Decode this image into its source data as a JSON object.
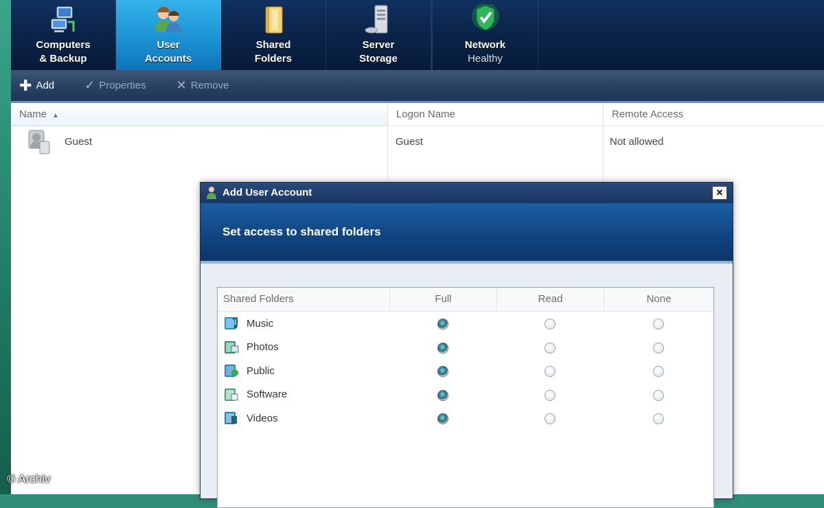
{
  "nav": {
    "tabs": [
      {
        "line1": "Computers",
        "line2": "& Backup",
        "icon": "computers-icon"
      },
      {
        "line1": "User",
        "line2": "Accounts",
        "icon": "users-icon"
      },
      {
        "line1": "Shared",
        "line2": "Folders",
        "icon": "folder-icon"
      },
      {
        "line1": "Server",
        "line2": "Storage",
        "icon": "server-icon"
      },
      {
        "line1": "Network",
        "line2": "Healthy",
        "icon": "shield-check-icon"
      }
    ],
    "active_index": 1
  },
  "toolbar": {
    "add_label": "Add",
    "properties_label": "Properties",
    "remove_label": "Remove"
  },
  "list": {
    "columns": {
      "name": "Name",
      "logon": "Logon Name",
      "remote": "Remote Access"
    },
    "rows": [
      {
        "name": "Guest",
        "logon": "Guest",
        "remote": "Not allowed"
      }
    ]
  },
  "dialog": {
    "title": "Add User Account",
    "heading": "Set access to shared folders",
    "columns": {
      "folders": "Shared Folders",
      "full": "Full",
      "read": "Read",
      "none": "None"
    },
    "folders": [
      {
        "name": "Music",
        "access": "Full"
      },
      {
        "name": "Photos",
        "access": "Full"
      },
      {
        "name": "Public",
        "access": "Full"
      },
      {
        "name": "Software",
        "access": "Full"
      },
      {
        "name": "Videos",
        "access": "Full"
      }
    ]
  },
  "watermark": "© Archiv",
  "colors": {
    "nav_bg": "#0a2347",
    "active_tab": "#1a8fd3",
    "banner": "#11437f"
  }
}
